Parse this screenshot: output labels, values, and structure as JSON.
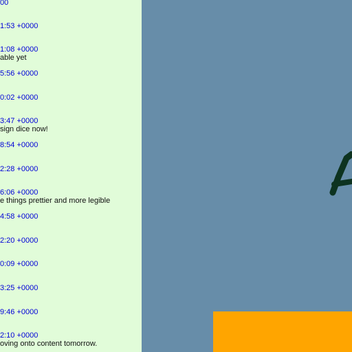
{
  "log": {
    "entries": [
      {
        "time": "00",
        "message": ""
      },
      {
        "time": "1:53 +0000",
        "message": ""
      },
      {
        "time": "1:08 +0000",
        "message": "able yet"
      },
      {
        "time": "5:56 +0000",
        "message": ""
      },
      {
        "time": "0:02 +0000",
        "message": ""
      },
      {
        "time": "3:47 +0000",
        "message": "sign dice now!"
      },
      {
        "time": "8:54 +0000",
        "message": ""
      },
      {
        "time": "2:28 +0000",
        "message": ""
      },
      {
        "time": "6:06 +0000",
        "message": "e things prettier and more legible"
      },
      {
        "time": "4:58 +0000",
        "message": ""
      },
      {
        "time": "2:20 +0000",
        "message": ""
      },
      {
        "time": "0:09 +0000",
        "message": ""
      },
      {
        "time": "3:25 +0000",
        "message": ""
      },
      {
        "time": "9:46 +0000",
        "message": ""
      },
      {
        "time": "2:10 +0000",
        "message": "oving onto content tomorrow."
      }
    ]
  },
  "canvas": {
    "background_color": "#678da9",
    "glyph_color": "#0d3320",
    "block_color": "#ffa500"
  },
  "panel_color": "#e1fcd9",
  "link_color": "#0000d8"
}
